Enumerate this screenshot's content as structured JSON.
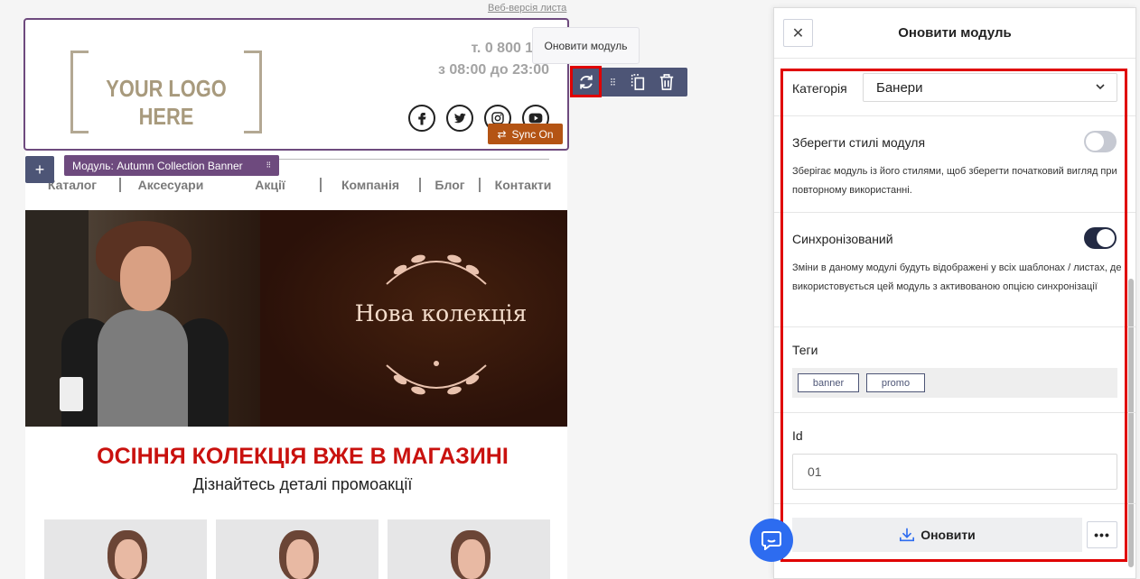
{
  "email": {
    "web_version_link": "Веб-версія листа",
    "logo_text": "YOUR LOGO HERE",
    "phone": "т. 0 800 123",
    "hours": "з 08:00 до 23:00",
    "socials": [
      "facebook-icon",
      "twitter-icon",
      "instagram-icon",
      "youtube-icon"
    ],
    "nav": [
      "Каталог",
      "Аксесуари",
      "Акції",
      "Компанія",
      "Блог",
      "Контакти"
    ],
    "banner_text": "Нова колекція",
    "promo_title": "ОСІННЯ КОЛЕКЦІЯ ВЖЕ В МАГАЗИНІ",
    "promo_subtitle": "Дізнайтесь деталі промоакції"
  },
  "editor": {
    "tooltip": "Оновити модуль",
    "sync_badge": "Sync On",
    "module_label": "Модуль: Autumn Collection Banner",
    "add_label": "+"
  },
  "panel": {
    "title": "Оновити модуль",
    "category_label": "Категорія",
    "category_value": "Банери",
    "keep_styles_label": "Зберегти стилі модуля",
    "keep_styles_desc": "Зберігає модуль із його стилями, щоб зберегти початковий вигляд при повторному використанні.",
    "keep_styles_on": false,
    "synced_label": "Синхронізований",
    "synced_desc": "Зміни в даному модулі будуть відображені у всіх шаблонах / листах, де використовується цей модуль з активованою опцією синхронізації",
    "synced_on": true,
    "tags_label": "Теги",
    "tags": [
      "banner",
      "promo"
    ],
    "id_label": "Id",
    "id_value": "01",
    "update_button": "Оновити",
    "more_button": "•••"
  },
  "colors": {
    "accent_toolbar": "#4d5576",
    "module_purple": "#6e4a7e",
    "sync_orange": "#b45414",
    "promo_red": "#c9110e",
    "highlight_red": "#e00000",
    "chat_blue": "#2d6cf0"
  }
}
